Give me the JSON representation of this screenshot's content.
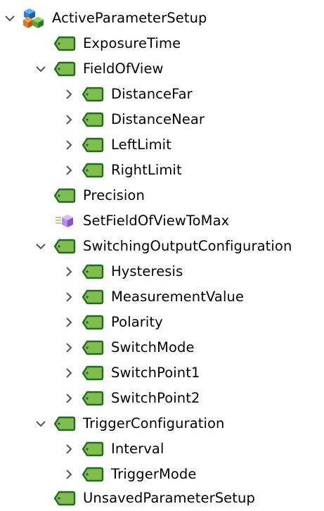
{
  "colors": {
    "tag_fill": "#7fbd4d",
    "tag_stroke": "#1f6c21",
    "chevron": "#555555",
    "method_purple": "#8c4fd6",
    "method_lines": "#a9c84a"
  },
  "tree": {
    "root": {
      "label": "ActiveParameterSetup",
      "icon": "cubes-icon",
      "expanded": true
    },
    "items": [
      {
        "label": "ExposureTime",
        "icon": "tag-icon"
      },
      {
        "label": "FieldOfView",
        "icon": "tag-icon",
        "expanded": true
      },
      {
        "label": "DistanceFar",
        "icon": "tag-icon",
        "collapsed": true
      },
      {
        "label": "DistanceNear",
        "icon": "tag-icon",
        "collapsed": true
      },
      {
        "label": "LeftLimit",
        "icon": "tag-icon",
        "collapsed": true
      },
      {
        "label": "RightLimit",
        "icon": "tag-icon",
        "collapsed": true
      },
      {
        "label": "Precision",
        "icon": "tag-icon"
      },
      {
        "label": "SetFieldOfViewToMax",
        "icon": "method-icon"
      },
      {
        "label": "SwitchingOutputConfiguration",
        "icon": "tag-icon",
        "expanded": true
      },
      {
        "label": "Hysteresis",
        "icon": "tag-icon",
        "collapsed": true
      },
      {
        "label": "MeasurementValue",
        "icon": "tag-icon",
        "collapsed": true
      },
      {
        "label": "Polarity",
        "icon": "tag-icon",
        "collapsed": true
      },
      {
        "label": "SwitchMode",
        "icon": "tag-icon",
        "collapsed": true
      },
      {
        "label": "SwitchPoint1",
        "icon": "tag-icon",
        "collapsed": true
      },
      {
        "label": "SwitchPoint2",
        "icon": "tag-icon",
        "collapsed": true
      },
      {
        "label": "TriggerConfiguration",
        "icon": "tag-icon",
        "expanded": true
      },
      {
        "label": "Interval",
        "icon": "tag-icon",
        "collapsed": true
      },
      {
        "label": "TriggerMode",
        "icon": "tag-icon",
        "collapsed": true
      },
      {
        "label": "UnsavedParameterSetup",
        "icon": "tag-icon"
      }
    ]
  }
}
